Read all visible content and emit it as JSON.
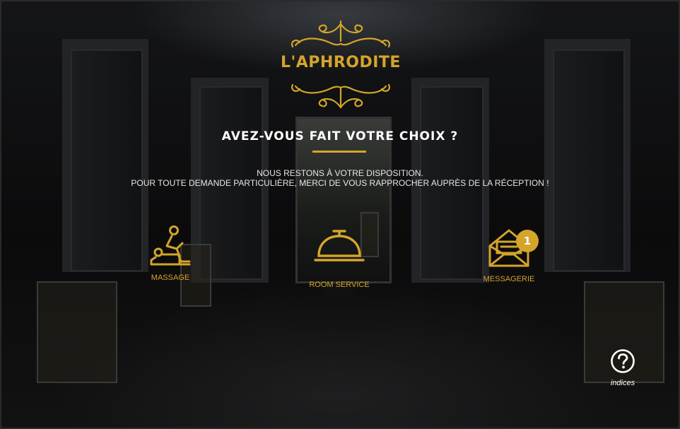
{
  "brand": {
    "name": "L'APHRODITE"
  },
  "heading": "AVEZ-VOUS FAIT VOTRE CHOIX ?",
  "message": {
    "line1": "NOUS RESTONS À VOTRE DISPOSITION.",
    "line2": "POUR TOUTE DEMANDE PARTICULIÈRE, MERCI DE VOUS RAPPROCHER AUPRÈS DE LA RÉCEPTION !"
  },
  "options": [
    {
      "label": "MASSAGE",
      "icon": "massage-icon"
    },
    {
      "label": "ROOM SERVICE",
      "icon": "service-bell-icon"
    },
    {
      "label": "MESSAGERIE",
      "icon": "envelope-icon",
      "badge": "1"
    }
  ],
  "help": {
    "label": "indices",
    "icon": "question-circle-icon"
  },
  "colors": {
    "accent": "#d4a52a",
    "background": "#0d0d0f",
    "text": "#ffffff"
  }
}
